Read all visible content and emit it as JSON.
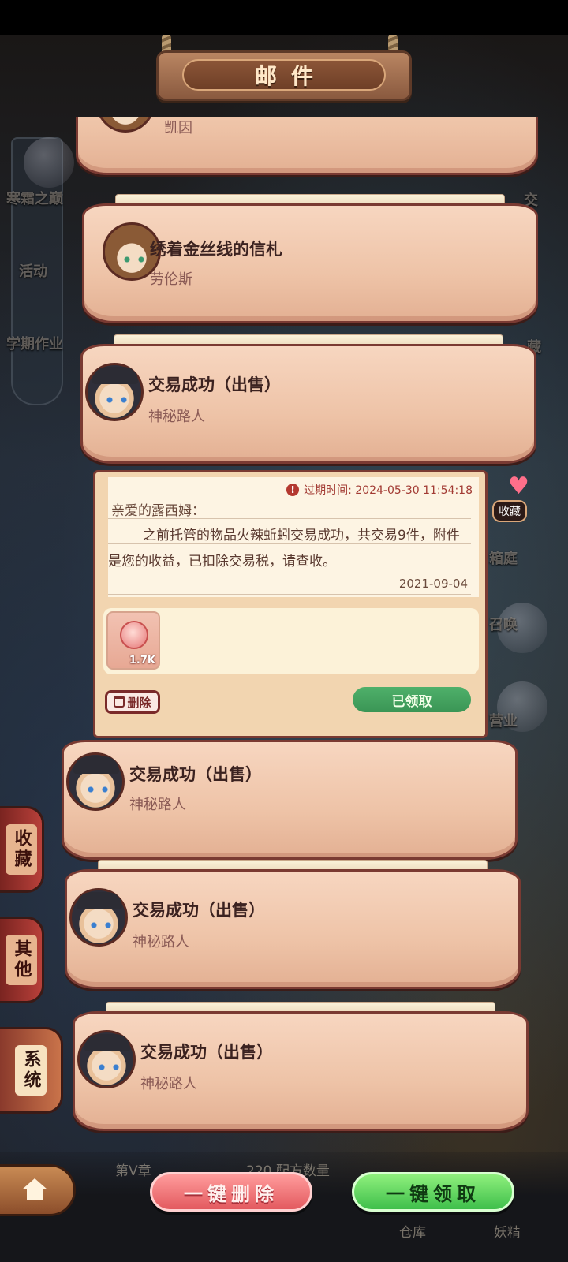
{
  "header": {
    "title": "邮件"
  },
  "background": {
    "left_labels": [
      "寒霜之巅",
      "活动",
      "学期作业"
    ],
    "right_labels": [
      "交",
      "藏",
      "箱庭",
      "召唤",
      "营业",
      "妖精"
    ],
    "bottom_chapter": "第V章",
    "bottom_recipes": "220 配方数量",
    "bottom_warehouse": "仓库"
  },
  "mails": [
    {
      "title": "",
      "sender": "凯因",
      "avatar": "brown-hair"
    },
    {
      "title": "绣着金丝线的信札",
      "sender": "劳伦斯",
      "avatar": "brown-hair"
    },
    {
      "title": "交易成功（出售）",
      "sender": "神秘路人",
      "avatar": "black-hat"
    },
    {
      "title": "交易成功（出售）",
      "sender": "神秘路人",
      "avatar": "black-hat"
    },
    {
      "title": "交易成功（出售）",
      "sender": "神秘路人",
      "avatar": "black-hat"
    },
    {
      "title": "交易成功（出售）",
      "sender": "神秘路人",
      "avatar": "black-hat"
    }
  ],
  "expanded_mail": {
    "expiry_label": "过期时间: 2024-05-30 11:54:18",
    "greeting": "亲爱的露西姆：",
    "body": "之前托管的物品火辣蚯蚓交易成功，共交易9件，附件是您的收益，已扣除交易税，请查收。",
    "date": "2021-09-04",
    "attachment": {
      "count": "1.7K",
      "icon": "coin-icon"
    },
    "delete_label": "删除",
    "claimed_label": "已领取",
    "favorite_label": "收藏"
  },
  "side_tabs": [
    {
      "label": "收藏",
      "active": false
    },
    {
      "label": "其他",
      "active": false
    },
    {
      "label": "系统",
      "active": true
    }
  ],
  "footer": {
    "delete_all_label": "一键删除",
    "claim_all_label": "一键领取"
  },
  "colors": {
    "accent_green": "#3fbf4b",
    "accent_red": "#e35a5f",
    "card_border": "#7a3a32"
  }
}
